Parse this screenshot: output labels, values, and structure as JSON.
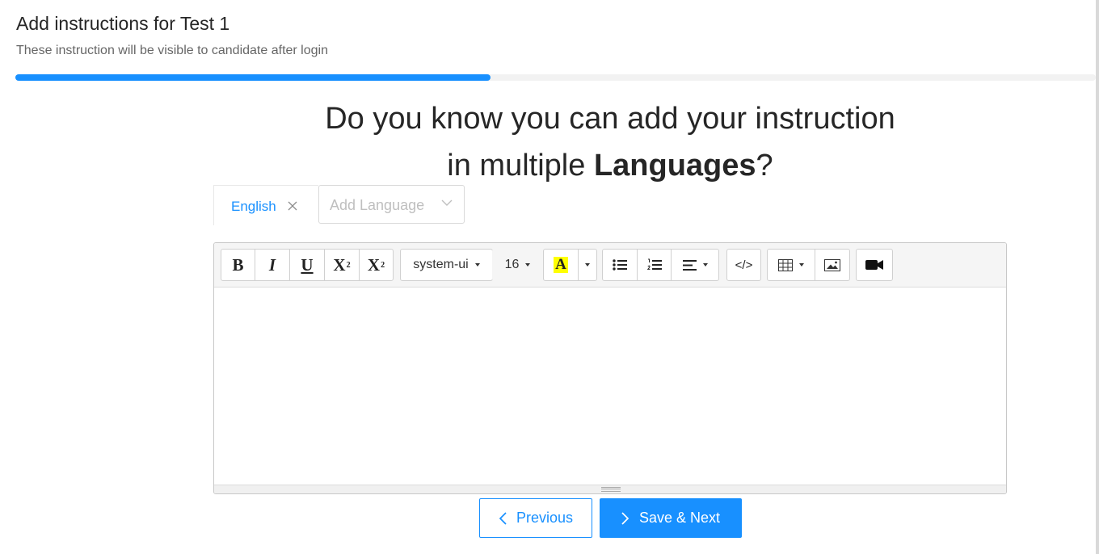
{
  "header": {
    "title": "Add instructions for Test 1",
    "subtitle": "These instruction will be visible to candidate after login"
  },
  "progress": {
    "fraction": 0.44
  },
  "headline": {
    "line1": "Do you know you can add your instruction",
    "line2_prefix": "in multiple ",
    "line2_bold": "Languages",
    "line2_suffix": "?"
  },
  "languages": {
    "active_tab": "English",
    "add_placeholder": "Add Language"
  },
  "toolbar": {
    "font_family": "system-ui",
    "font_size": "16",
    "highlight_letter": "A",
    "highlight_color": "#ffff00",
    "bold_glyph": "B",
    "italic_glyph": "I",
    "underline_glyph": "U",
    "superscript_glyph": "X",
    "subscript_glyph": "X",
    "superscript_mark": "2",
    "subscript_mark": "2",
    "code_glyph": "</>"
  },
  "buttons": {
    "previous": "Previous",
    "save_next": "Save & Next"
  },
  "colors": {
    "primary": "#1890ff",
    "progress_track": "#f2f2f2"
  }
}
